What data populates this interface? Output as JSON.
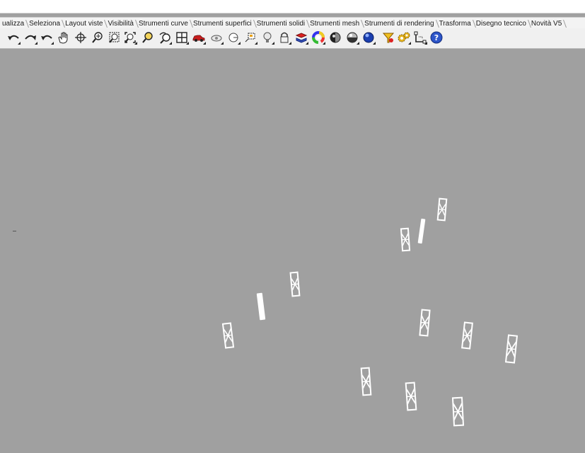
{
  "tabs": [
    "ualizza",
    "Seleziona",
    "Layout viste",
    "Visibilità",
    "Strumenti curve",
    "Strumenti superfici",
    "Strumenti solidi",
    "Strumenti mesh",
    "Strumenti di rendering",
    "Trasforma",
    "Disegno tecnico",
    "Novità V5"
  ],
  "toolbar": {
    "icons": [
      "undo-view-icon",
      "redo-view-icon",
      "undo-icon",
      "pan-hand-icon",
      "rotate-view-icon",
      "zoom-dynamic-icon",
      "zoom-window-icon",
      "zoom-extents-icon",
      "zoom-selected-icon",
      "undo-view-change-icon",
      "four-viewports-icon",
      "car-icon",
      "camera-icon",
      "named-views-icon",
      "capture-icon",
      "light-bulb-icon",
      "lock-icon",
      "layer-icon",
      "color-wheel-icon",
      "shaded-sphere-icon",
      "rendered-sphere-icon",
      "blue-sphere-icon",
      "filter-icon",
      "gears-icon",
      "osnap-icon",
      "help-icon"
    ]
  },
  "colors": {
    "viewport_background": "#a0a0a0",
    "object_color": "#ffffff",
    "tab_background": "#f3f3f3",
    "toolbar_background": "#f0f0f0"
  }
}
